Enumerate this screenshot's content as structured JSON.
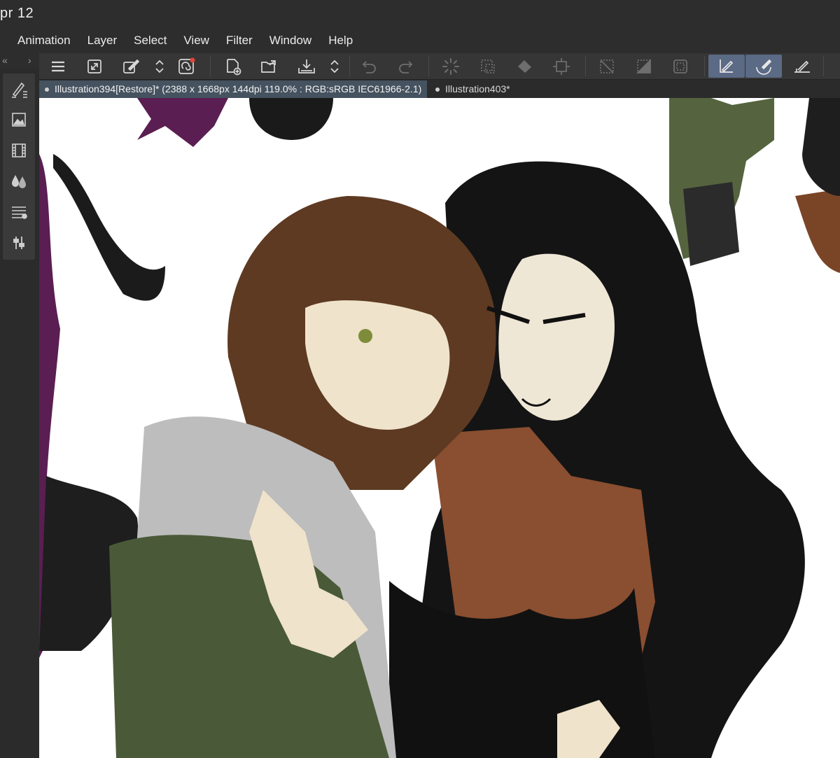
{
  "status_bar": {
    "time": "pr 12"
  },
  "menu": [
    "Animation",
    "Layer",
    "Select",
    "View",
    "Filter",
    "Window",
    "Help"
  ],
  "toolbar": {
    "buttons": [
      {
        "icon": "menu-icon",
        "state": "normal"
      },
      {
        "icon": "canvas-resize-icon",
        "state": "normal"
      },
      {
        "icon": "transform-pen-icon",
        "state": "normal"
      },
      {
        "icon": "chevron-updown-icon",
        "state": "normal"
      },
      {
        "icon": "clip-studio-logo-icon",
        "state": "normal"
      },
      {
        "icon": "new-file-icon",
        "state": "normal"
      },
      {
        "icon": "open-folder-icon",
        "state": "normal"
      },
      {
        "icon": "save-download-icon",
        "state": "normal"
      },
      {
        "icon": "chevron-updown-icon",
        "state": "normal"
      },
      {
        "icon": "undo-icon",
        "state": "disabled"
      },
      {
        "icon": "redo-icon",
        "state": "disabled"
      },
      {
        "icon": "loading-spinner-icon",
        "state": "disabled"
      },
      {
        "icon": "dotted-select-icon",
        "state": "disabled"
      },
      {
        "icon": "fill-bucket-icon",
        "state": "disabled"
      },
      {
        "icon": "transform-box-icon",
        "state": "disabled"
      },
      {
        "icon": "clear-selection-icon",
        "state": "disabled"
      },
      {
        "icon": "invert-selection-icon",
        "state": "disabled"
      },
      {
        "icon": "selection-frame-icon",
        "state": "disabled"
      },
      {
        "icon": "stabilizer-pen-icon",
        "state": "active"
      },
      {
        "icon": "brush-curve-icon",
        "state": "active"
      },
      {
        "icon": "ruler-snap-icon",
        "state": "normal"
      }
    ]
  },
  "left_panel": {
    "collapse_left": "«",
    "collapse_right": "›",
    "tools": [
      "tool-property-icon",
      "navigator-icon",
      "timeline-icon",
      "color-icon",
      "layer-list-icon",
      "adjust-icon"
    ]
  },
  "tabs": [
    {
      "label": "Illustration394[Restore]* (2388 x 1668px 144dpi 119.0% : RGB:sRGB IEC61966-2.1)",
      "active": true
    },
    {
      "label": "Illustration403*",
      "active": false
    }
  ],
  "canvas": {
    "background": "#ffffff"
  },
  "colors": {
    "chrome_dark": "#2d2d2d",
    "toolbar_bg": "#363636",
    "active_tab": "#45525f",
    "active_tool": "#5b6a85",
    "hair_brown": "#5e3a22",
    "hair_black": "#141414",
    "jacket_green": "#4a5a38",
    "skin": "#efe3cb",
    "purple": "#5a1e52"
  }
}
